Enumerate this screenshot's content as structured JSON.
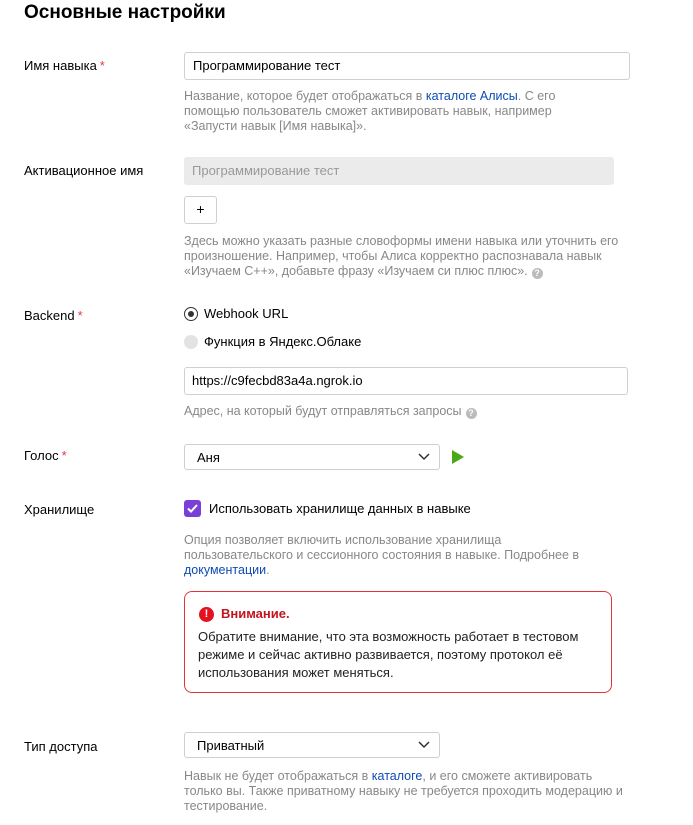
{
  "section": {
    "title": "Основные настройки"
  },
  "skill_name": {
    "label": "Имя навыка",
    "required_mark": "*",
    "value": "Программирование тест",
    "help_before": "Название, которое будет отображаться в ",
    "help_link": "каталоге Алисы",
    "help_after": ". С его помощью пользователь сможет активировать навык, например «Запусти навык [Имя навыка]»."
  },
  "activation_name": {
    "label": "Активационное имя",
    "value": "Программирование тест",
    "add_label": "+",
    "help": "Здесь можно указать разные словоформы имени навыка или уточнить его произношение. Например, чтобы Алиса корректно распознавала навык «Изучаем С++», добавьте фразу «Изучаем си плюс плюс».",
    "help_icon": "?"
  },
  "backend": {
    "label": "Backend",
    "required_mark": "*",
    "option_webhook": "Webhook URL",
    "option_function": "Функция в Яндекс.Облаке",
    "url_value": "https://c9fecbd83a4a.ngrok.io",
    "help": "Адрес, на который будут отправляться запросы",
    "help_icon": "?"
  },
  "voice": {
    "label": "Голос",
    "required_mark": "*",
    "selected": "Аня",
    "play_icon": "play-icon"
  },
  "storage": {
    "label": "Хранилище",
    "checkbox_label": "Использовать хранилище данных в навыке",
    "checked": true,
    "help_before": "Опция позволяет включить использование хранилища пользовательского и сессионного состояния в навыке. Подробнее в ",
    "help_link": "документации",
    "help_after": ".",
    "warning_icon": "!",
    "warning_title": "Внимание.",
    "warning_text": "Обратите внимание, что эта возможность работает в тестовом режиме и сейчас активно развивается, поэтому протокол её использования может меняться."
  },
  "access": {
    "label": "Тип доступа",
    "selected": "Приватный",
    "help_before": "Навык не будет отображаться в ",
    "help_link": "каталоге",
    "help_after": ", и его сможете активировать только вы. Также приватному навыку не требуется проходить модерацию и тестирование."
  },
  "colors": {
    "accent_purple": "#7b3fd9",
    "warning_red": "#e3121f",
    "link_blue": "#0d4bb3",
    "play_green": "#4aa819"
  }
}
